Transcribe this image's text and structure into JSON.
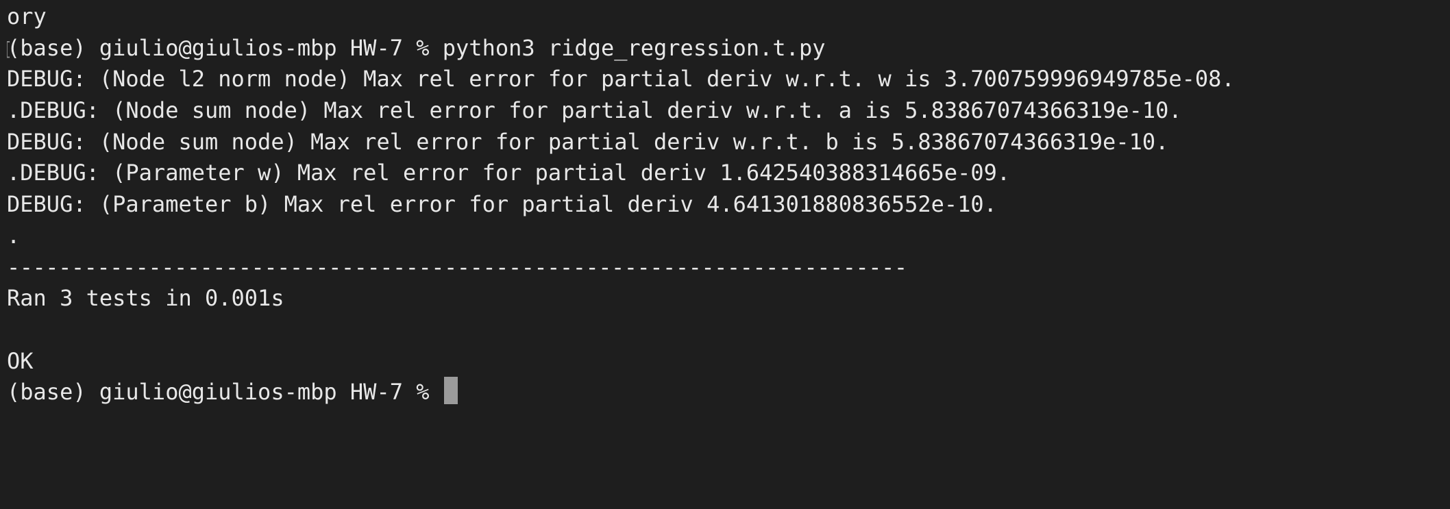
{
  "terminal": {
    "lines": [
      "ory",
      "(base) giulio@giulios-mbp HW-7 % python3 ridge_regression.t.py",
      "DEBUG: (Node l2 norm node) Max rel error for partial deriv w.r.t. w is 3.700759996949785e-08.",
      ".DEBUG: (Node sum node) Max rel error for partial deriv w.r.t. a is 5.83867074366319e-10.",
      "DEBUG: (Node sum node) Max rel error for partial deriv w.r.t. b is 5.83867074366319e-10.",
      ".DEBUG: (Parameter w) Max rel error for partial deriv 1.642540388314665e-09.",
      "DEBUG: (Parameter b) Max rel error for partial deriv 4.641301880836552e-10.",
      ".",
      "----------------------------------------------------------------------",
      "Ran 3 tests in 0.001s",
      "",
      "OK",
      "(base) giulio@giulios-mbp HW-7 % "
    ],
    "prompt_marker": "[",
    "colors": {
      "background": "#1e1e1e",
      "foreground": "#e8e8e8",
      "cursor": "#9b9b9b"
    }
  }
}
